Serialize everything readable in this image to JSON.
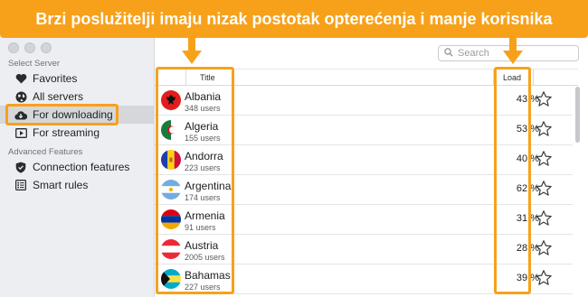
{
  "banner": {
    "text": "Brzi poslužitelji imaju nizak postotak opterećenja i manje korisnika"
  },
  "sidebar": {
    "section1": "Select Server",
    "items": [
      {
        "label": "Favorites",
        "icon": "heart-icon"
      },
      {
        "label": "All servers",
        "icon": "globe-icon"
      },
      {
        "label": "For downloading",
        "icon": "cloud-download-icon",
        "selected": true
      },
      {
        "label": "For streaming",
        "icon": "play-icon"
      }
    ],
    "section2": "Advanced Features",
    "items2": [
      {
        "label": "Connection features",
        "icon": "shield-icon"
      },
      {
        "label": "Smart rules",
        "icon": "list-icon"
      }
    ]
  },
  "search": {
    "placeholder": "Search"
  },
  "table": {
    "headers": {
      "title": "Title",
      "load": "Load"
    },
    "rows": [
      {
        "country": "Albania",
        "users": "348 users",
        "load": "43 %"
      },
      {
        "country": "Algeria",
        "users": "155 users",
        "load": "53 %"
      },
      {
        "country": "Andorra",
        "users": "223 users",
        "load": "40 %"
      },
      {
        "country": "Argentina",
        "users": "174 users",
        "load": "62 %"
      },
      {
        "country": "Armenia",
        "users": "91 users",
        "load": "31 %"
      },
      {
        "country": "Austria",
        "users": "2005 users",
        "load": "28 %"
      },
      {
        "country": "Bahamas",
        "users": "227 users",
        "load": "39 %"
      }
    ]
  },
  "colors": {
    "highlight": "#f7a11a",
    "selected_bg": "#d5d7db",
    "sidebar_bg": "#eceef1"
  }
}
